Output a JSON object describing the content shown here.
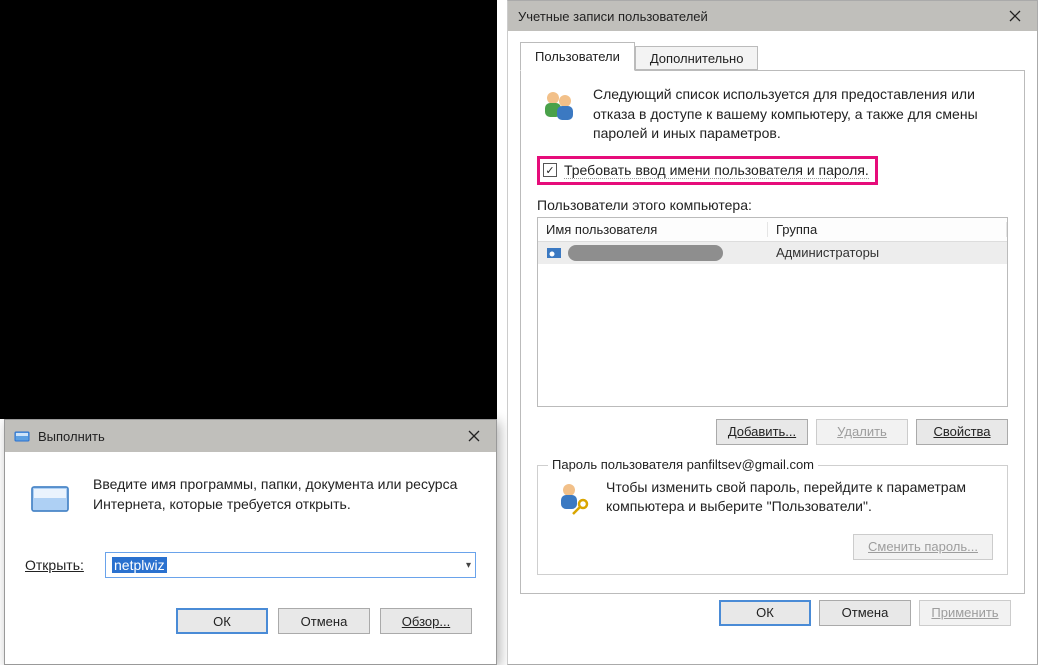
{
  "run": {
    "title": "Выполнить",
    "description": "Введите имя программы, папки, документа или ресурса Интернета, которые требуется открыть.",
    "label": "Открыть:",
    "value": "netplwiz",
    "buttons": {
      "ok": "ОК",
      "cancel": "Отмена",
      "browse": "Обзор..."
    }
  },
  "ua": {
    "title": "Учетные записи пользователей",
    "tabs": {
      "users": "Пользователи",
      "advanced": "Дополнительно"
    },
    "info": "Следующий список используется для предоставления или отказа в доступе к вашему компьютеру, а также для смены паролей и иных параметров.",
    "checkbox_label": "Требовать ввод имени пользователя и пароля.",
    "checkbox_checked": true,
    "list_label": "Пользователи этого компьютера:",
    "columns": {
      "user": "Имя пользователя",
      "group": "Группа"
    },
    "rows": [
      {
        "group": "Администраторы"
      }
    ],
    "actions": {
      "add": "Добавить...",
      "remove": "Удалить",
      "properties": "Свойства"
    },
    "password_section": {
      "legend": "Пароль пользователя panfiltsev@gmail.com",
      "text": "Чтобы изменить свой пароль, перейдите к параметрам компьютера и выберите \"Пользователи\".",
      "button": "Сменить пароль..."
    },
    "footer": {
      "ok": "ОК",
      "cancel": "Отмена",
      "apply": "Применить"
    }
  }
}
